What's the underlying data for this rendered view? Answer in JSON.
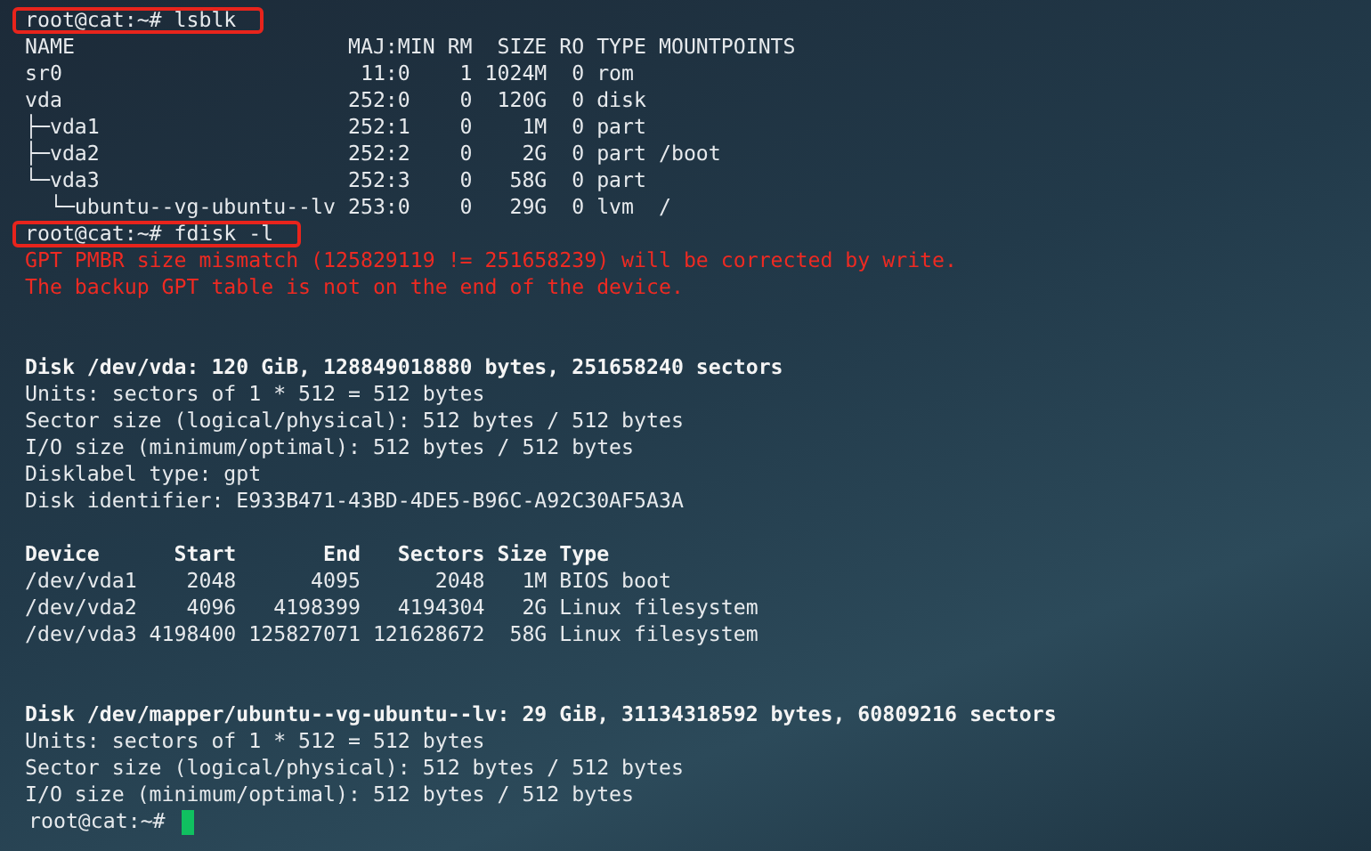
{
  "terminal": {
    "lines": [
      {
        "kind": "prompt",
        "text": "root@cat:~# lsblk",
        "highlighted": true
      },
      {
        "kind": "output",
        "text": "NAME                      MAJ:MIN RM  SIZE RO TYPE MOUNTPOINTS"
      },
      {
        "kind": "output",
        "text": "sr0                        11:0    1 1024M  0 rom"
      },
      {
        "kind": "output",
        "text": "vda                       252:0    0  120G  0 disk"
      },
      {
        "kind": "output",
        "text": "├─vda1                    252:1    0    1M  0 part"
      },
      {
        "kind": "output",
        "text": "├─vda2                    252:2    0    2G  0 part /boot"
      },
      {
        "kind": "output",
        "text": "└─vda3                    252:3    0   58G  0 part"
      },
      {
        "kind": "output",
        "text": "  └─ubuntu--vg-ubuntu--lv 253:0    0   29G  0 lvm  /"
      },
      {
        "kind": "prompt",
        "text": "root@cat:~# fdisk -l",
        "highlighted": true
      },
      {
        "kind": "error",
        "text": "GPT PMBR size mismatch (125829119 != 251658239) will be corrected by write."
      },
      {
        "kind": "error",
        "text": "The backup GPT table is not on the end of the device."
      },
      {
        "kind": "blank"
      },
      {
        "kind": "blank"
      },
      {
        "kind": "heading",
        "text": "Disk /dev/vda: 120 GiB, 128849018880 bytes, 251658240 sectors"
      },
      {
        "kind": "output",
        "text": "Units: sectors of 1 * 512 = 512 bytes"
      },
      {
        "kind": "output",
        "text": "Sector size (logical/physical): 512 bytes / 512 bytes"
      },
      {
        "kind": "output",
        "text": "I/O size (minimum/optimal): 512 bytes / 512 bytes"
      },
      {
        "kind": "output",
        "text": "Disklabel type: gpt"
      },
      {
        "kind": "output",
        "text": "Disk identifier: E933B471-43BD-4DE5-B96C-A92C30AF5A3A"
      },
      {
        "kind": "blank"
      },
      {
        "kind": "heading",
        "text": "Device      Start       End   Sectors Size Type"
      },
      {
        "kind": "output",
        "text": "/dev/vda1    2048      4095      2048   1M BIOS boot"
      },
      {
        "kind": "output",
        "text": "/dev/vda2    4096   4198399   4194304   2G Linux filesystem"
      },
      {
        "kind": "output",
        "text": "/dev/vda3 4198400 125827071 121628672  58G Linux filesystem"
      },
      {
        "kind": "blank"
      },
      {
        "kind": "blank"
      },
      {
        "kind": "heading",
        "text": "Disk /dev/mapper/ubuntu--vg-ubuntu--lv: 29 GiB, 31134318592 bytes, 60809216 sectors"
      },
      {
        "kind": "output",
        "text": "Units: sectors of 1 * 512 = 512 bytes"
      },
      {
        "kind": "output",
        "text": "Sector size (logical/physical): 512 bytes / 512 bytes"
      },
      {
        "kind": "output",
        "text": "I/O size (minimum/optimal): 512 bytes / 512 bytes"
      },
      {
        "kind": "prompt",
        "text": "root@cat:~#",
        "highlighted": false,
        "cursor": true
      }
    ]
  }
}
